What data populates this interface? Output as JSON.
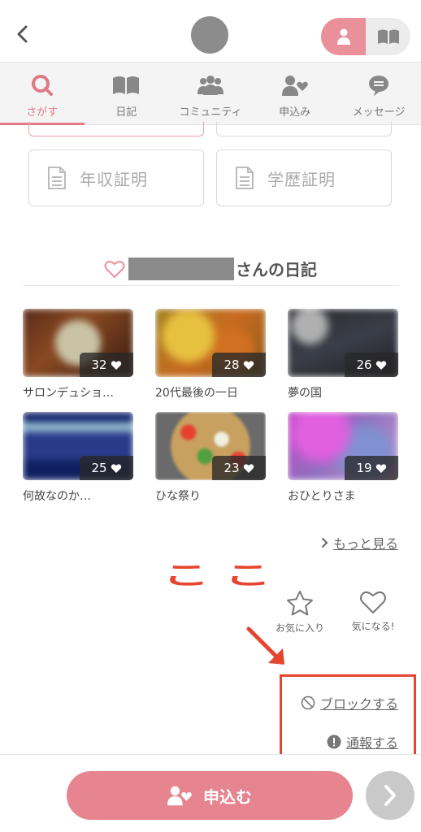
{
  "header": {
    "back_icon": "chevron-left-icon",
    "toggle": {
      "left_icon": "person-icon",
      "right_icon": "book-icon",
      "active_color": "#e9909a"
    }
  },
  "tabs": [
    {
      "label": "さがす",
      "icon": "search-icon",
      "active": true
    },
    {
      "label": "日記",
      "icon": "book-icon",
      "active": false
    },
    {
      "label": "コミュニティ",
      "icon": "group-icon",
      "active": false
    },
    {
      "label": "申込み",
      "icon": "person-heart-icon",
      "active": false
    },
    {
      "label": "メッセージ",
      "icon": "chat-bubble-icon",
      "active": false
    }
  ],
  "certificates": {
    "income": "年収証明",
    "education": "学歴証明"
  },
  "diary": {
    "title_suffix": "さんの日記",
    "items": [
      {
        "caption": "サロンデュショ…",
        "likes": "32"
      },
      {
        "caption": "20代最後の一日",
        "likes": "28"
      },
      {
        "caption": "夢の国",
        "likes": "26"
      },
      {
        "caption": "何故なのか…",
        "likes": "25"
      },
      {
        "caption": "ひな祭り",
        "likes": "23"
      },
      {
        "caption": "おひとりさま",
        "likes": "19"
      }
    ],
    "more_label": "もっと見る"
  },
  "annotation": {
    "text": "ここ",
    "color": "#e5442e"
  },
  "actions": {
    "favorite_label": "お気に入り",
    "interest_label": "気になる!"
  },
  "links": {
    "block_label": "ブロックする",
    "report_label": "通報する"
  },
  "footer": {
    "apply_label": "申込む",
    "next_icon": "chevron-right-icon"
  },
  "colors": {
    "accent": "#e07a86",
    "button_pink": "#e6858f"
  }
}
